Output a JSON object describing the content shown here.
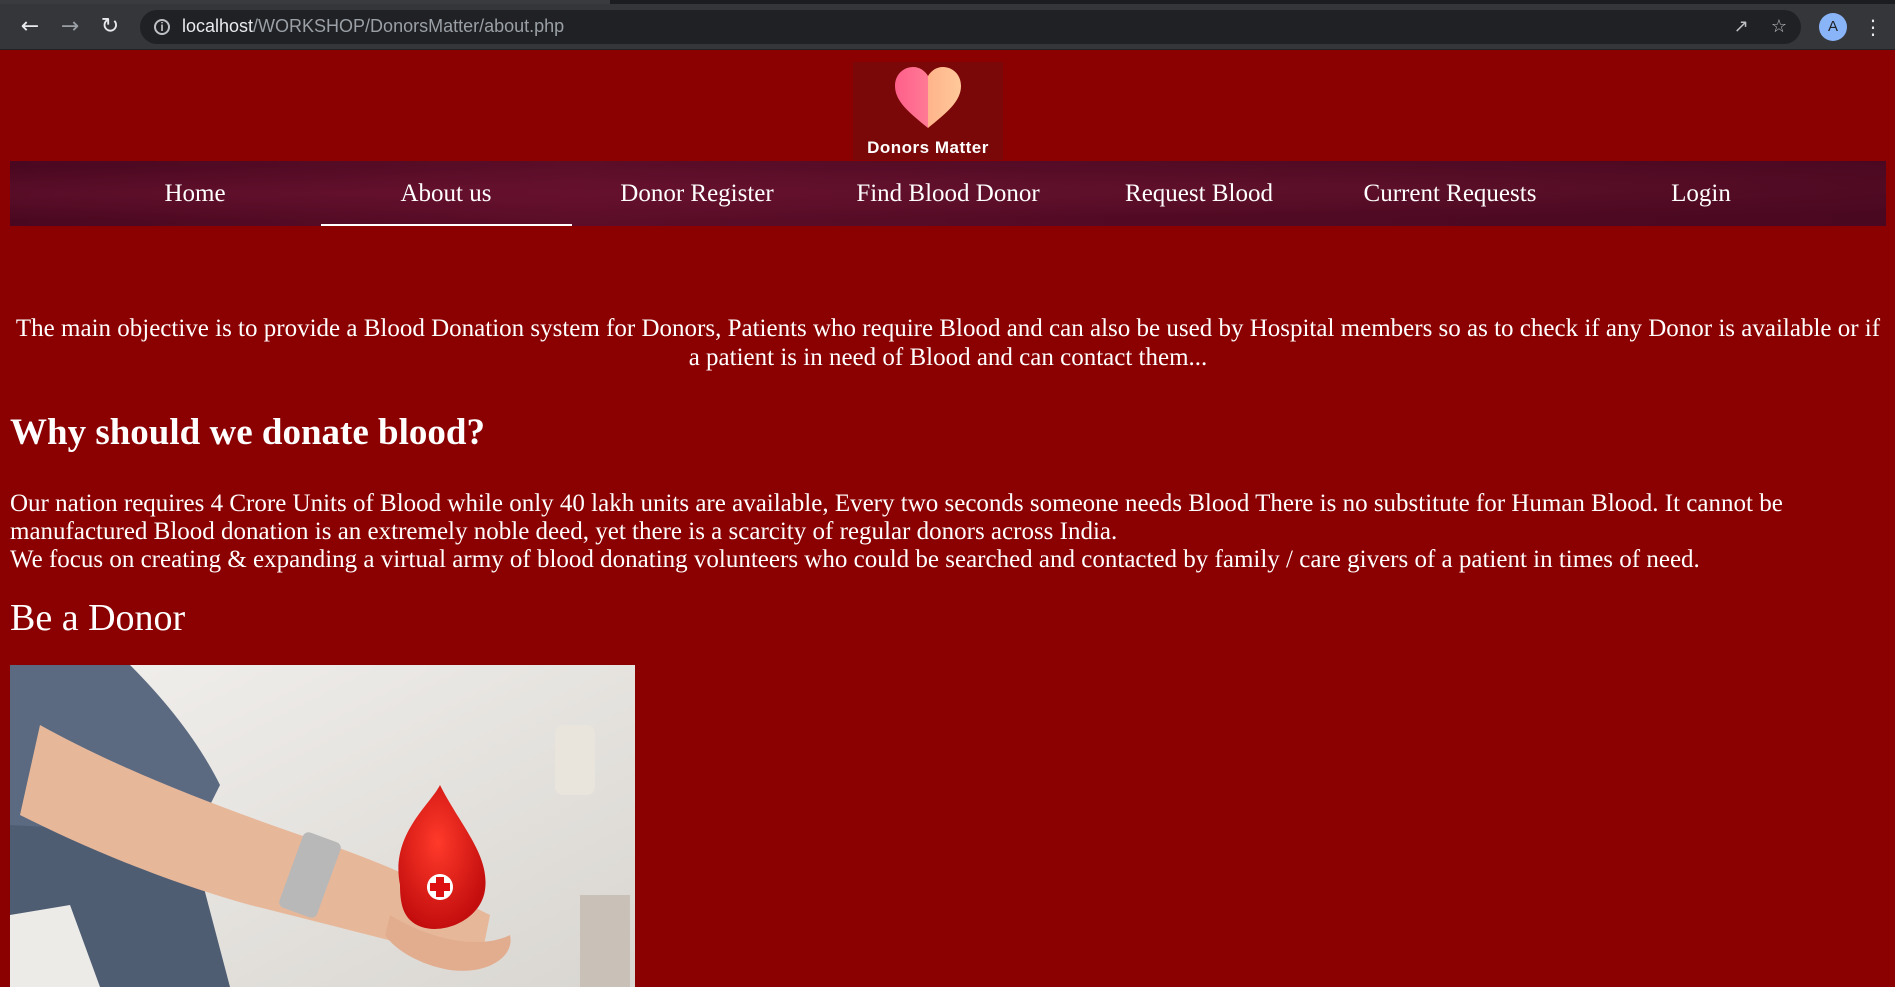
{
  "browser": {
    "url_host": "localhost",
    "url_path": "/WORKSHOP/DonorsMatter/about.php",
    "profile_initial": "A"
  },
  "logo": {
    "text": "Donors Matter"
  },
  "nav": {
    "items": [
      {
        "label": "Home"
      },
      {
        "label": "About us",
        "active": true
      },
      {
        "label": "Donor Register"
      },
      {
        "label": "Find Blood Donor"
      },
      {
        "label": "Request Blood"
      },
      {
        "label": "Current Requests"
      },
      {
        "label": "Login"
      }
    ]
  },
  "main": {
    "objective": "The main objective is to provide a Blood Donation system for Donors, Patients who require Blood and can also be used by Hospital members so as to check if any Donor is available or if a patient is in need of Blood and can contact them...",
    "why_heading": "Why should we donate blood?",
    "why_paragraph_1": "Our nation requires 4 Crore Units of Blood while only 40 lakh units are available, Every two seconds someone needs Blood There is no substitute for Human Blood. It cannot be manufactured Blood donation is an extremely noble deed, yet there is a scarcity of regular donors across India.",
    "why_paragraph_2": "We focus on creating & expanding a virtual army of blood donating volunteers who could be searched and contacted by family / care givers of a patient in times of need.",
    "donor_heading": "Be a Donor"
  },
  "colors": {
    "page_bg": "#8b0000",
    "nav_bg": "#520a24",
    "logo_heart": "#ff6f91"
  }
}
